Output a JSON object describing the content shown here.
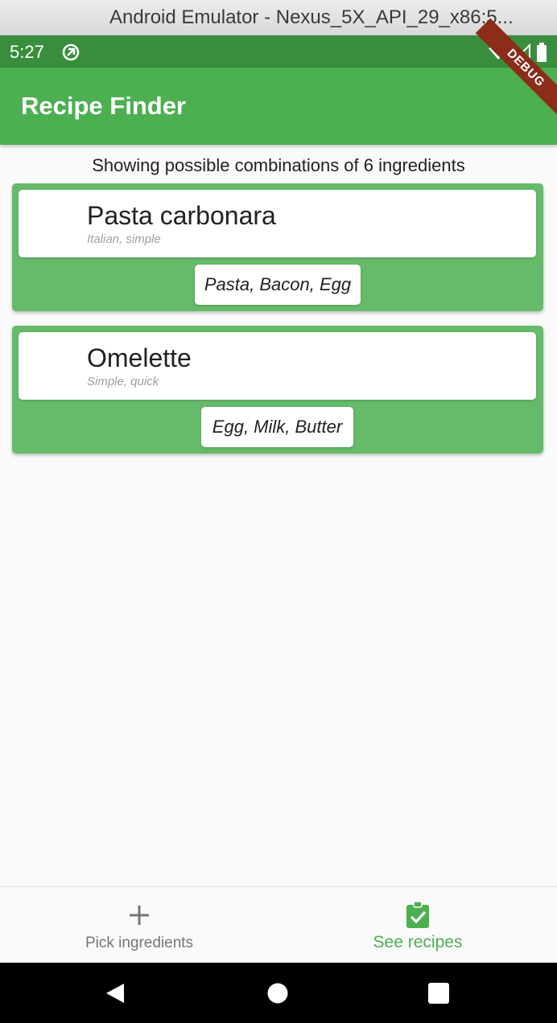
{
  "window": {
    "title": "Android Emulator - Nexus_5X_API_29_x86:5..."
  },
  "status_bar": {
    "time": "5:27",
    "notification_icon": "data-saver-icon",
    "icons": [
      "wifi-icon",
      "signal-icon",
      "battery-icon"
    ],
    "debug_banner": "DEBUG"
  },
  "app_bar": {
    "title": "Recipe Finder"
  },
  "summary": "Showing possible combinations of 6 ingredients",
  "recipes": [
    {
      "name": "Pasta carbonara",
      "tags": "Italian, simple",
      "ingredients": "Pasta, Bacon, Egg"
    },
    {
      "name": "Omelette",
      "tags": "Simple, quick",
      "ingredients": "Egg, Milk, Butter"
    }
  ],
  "bottom_nav": {
    "items": [
      {
        "label": "Pick ingredients",
        "icon": "add-icon",
        "selected": false
      },
      {
        "label": "See recipes",
        "icon": "clipboard-check-icon",
        "selected": true
      }
    ]
  },
  "system_nav": {
    "buttons": [
      "back-icon",
      "home-icon",
      "recents-icon"
    ]
  },
  "colors": {
    "primary": "#4caf50",
    "primary_dark": "#388e3c",
    "card": "#66bb6a",
    "debug_banner": "#8b2d1a",
    "nav_inactive": "#757575"
  }
}
